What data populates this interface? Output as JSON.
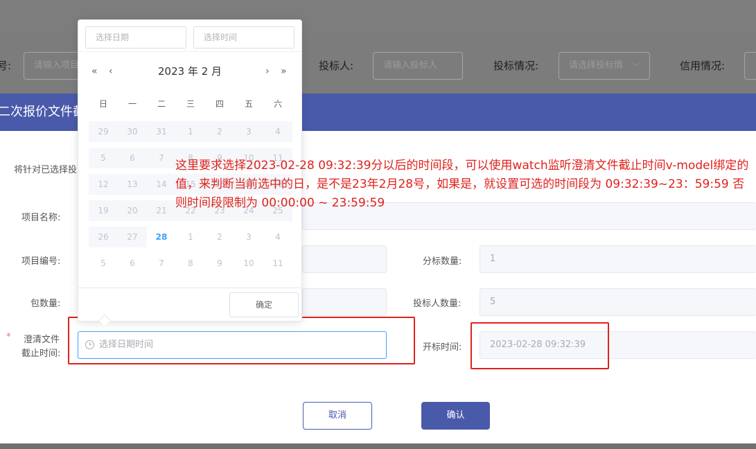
{
  "filter": {
    "label_partial": "号:",
    "project_placeholder": "请输入项目",
    "bidder_label": "投标人:",
    "bidder_placeholder": "请输入投标人",
    "bid_status_label": "投标情况:",
    "bid_status_placeholder": "请选择投标情",
    "credit_label": "信用情况:"
  },
  "dialog": {
    "title": "二次报价文件截",
    "intro_partial": "将针对已选择投",
    "fields": {
      "project_name_label": "项目名称:",
      "project_no_label": "项目编号:",
      "section_count_label": "分标数量:",
      "section_count_value": "1",
      "package_count_label": "包数量:",
      "bidder_count_label": "投标人数量:",
      "bidder_count_value": "5",
      "clarify_label_1": "澄清文件",
      "clarify_label_2": "截止时间:",
      "required_mark": "*",
      "clarify_placeholder": "选择日期时间",
      "open_time_label": "开标时间:",
      "open_time_value": "2023-02-28 09:32:39"
    },
    "buttons": {
      "cancel": "取消",
      "confirm": "确认"
    }
  },
  "picker": {
    "date_placeholder": "选择日期",
    "time_placeholder": "选择时间",
    "title": "2023 年  2 月",
    "nav": {
      "prev_year": "«",
      "prev_month": "‹",
      "next_month": "›",
      "next_year": "»"
    },
    "weekdays": [
      "日",
      "一",
      "二",
      "三",
      "四",
      "五",
      "六"
    ],
    "weeks": [
      [
        "29",
        "30",
        "31",
        "1",
        "2",
        "3",
        "4"
      ],
      [
        "5",
        "6",
        "7",
        "8",
        "9",
        "10",
        "11"
      ],
      [
        "12",
        "13",
        "14",
        "15",
        "16",
        "17",
        "18"
      ],
      [
        "19",
        "20",
        "21",
        "22",
        "23",
        "24",
        "25"
      ],
      [
        "26",
        "27",
        "28",
        "1",
        "2",
        "3",
        "4"
      ],
      [
        "5",
        "6",
        "7",
        "8",
        "9",
        "10",
        "11"
      ]
    ],
    "today": "28",
    "confirm": "确定"
  },
  "annotation": {
    "text": "这里要求选择2023-02-28 09:32:39分以后的时间段，可以使用watch监听澄清文件截止时间v-model绑定的值，来判断当前选中的日，是不是23年2月28号，如果是，就设置可选的时间段为 09:32:39~23：59:59 否则时间段限制为 00:00:00 ~ 23:59:59"
  },
  "colors": {
    "primary": "#4a5aaa",
    "annotation_red": "#e0211c",
    "today_blue": "#409eff"
  }
}
